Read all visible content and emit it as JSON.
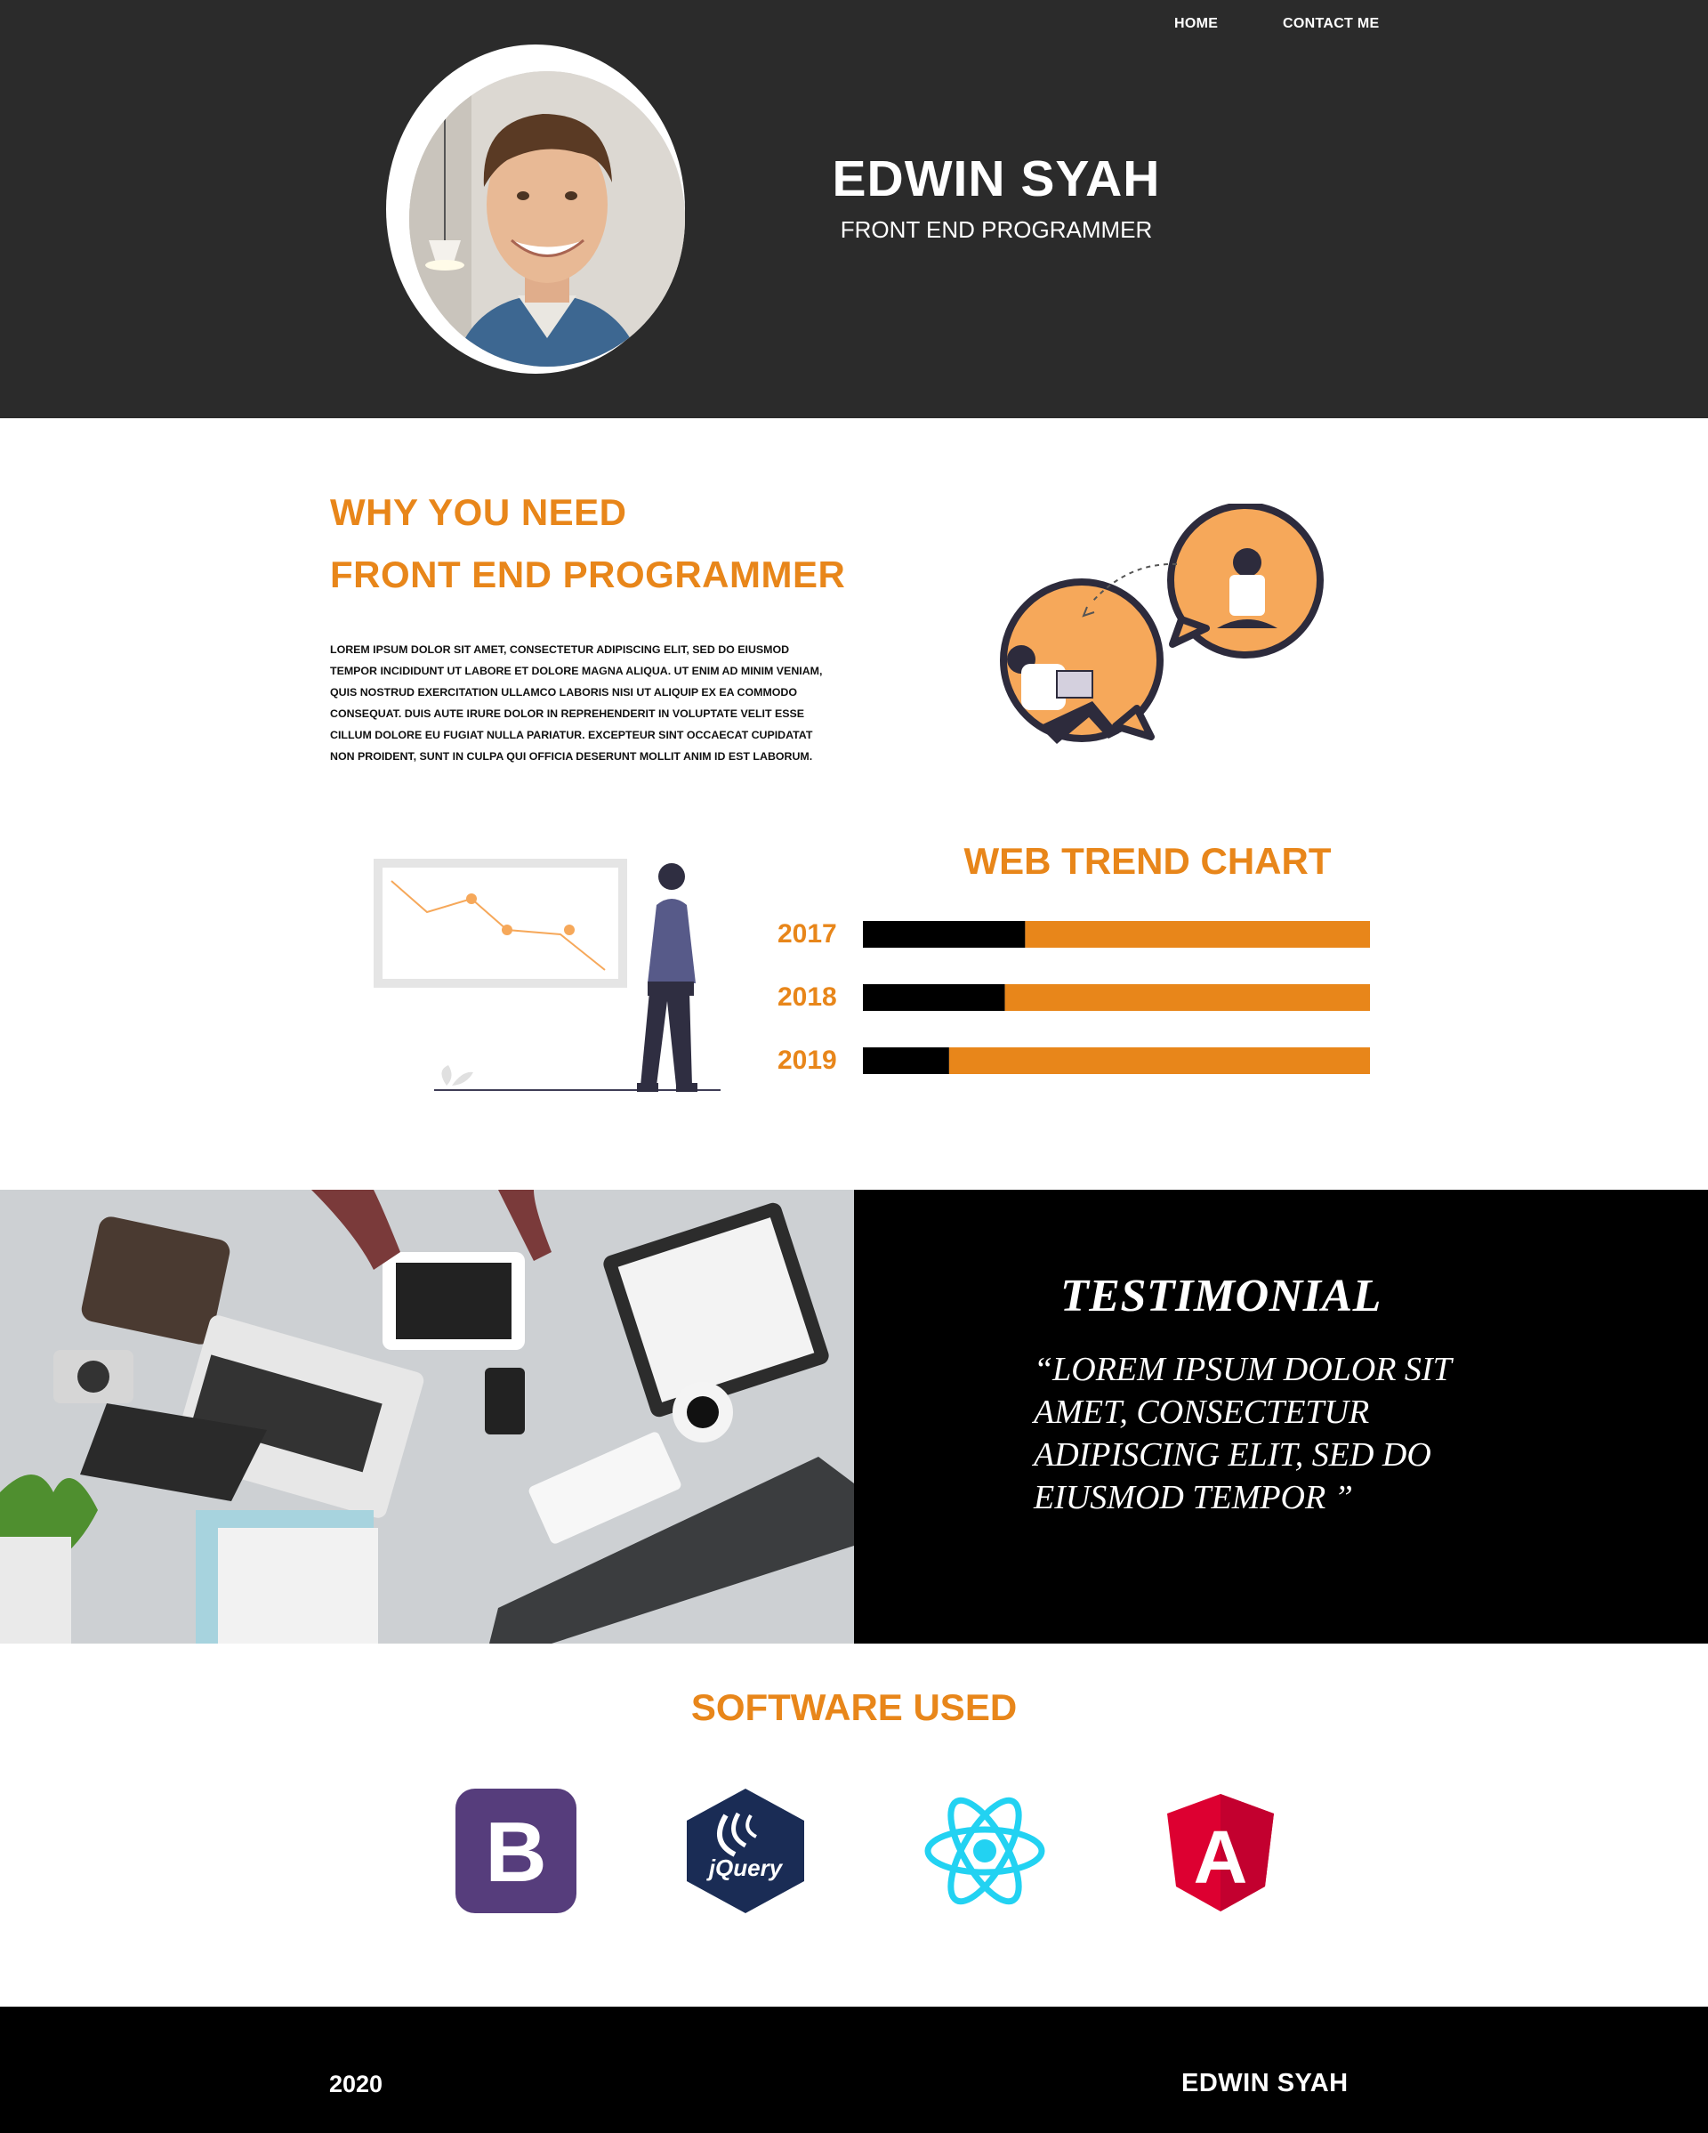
{
  "nav": {
    "home": "HOME",
    "contact": "CONTACT ME"
  },
  "hero": {
    "name": "EDWIN SYAH",
    "role": "FRONT END PROGRAMMER"
  },
  "why": {
    "title_line1": "WHY YOU NEED",
    "title_line2": "FRONT END PROGRAMMER",
    "body": "LOREM IPSUM DOLOR SIT AMET, CONSECTETUR ADIPISCING ELIT, SED DO EIUSMOD TEMPOR INCIDIDUNT UT LABORE ET DOLORE MAGNA ALIQUA. UT ENIM AD MINIM VENIAM, QUIS NOSTRUD EXERCITATION ULLAMCO LABORIS NISI UT ALIQUIP EX EA COMMODO CONSEQUAT. DUIS AUTE IRURE DOLOR IN REPREHENDERIT IN VOLUPTATE VELIT ESSE CILLUM DOLORE EU FUGIAT NULLA PARIATUR. EXCEPTEUR SINT OCCAECAT CUPIDATAT NON PROIDENT, SUNT IN CULPA QUI OFFICIA DESERUNT MOLLIT ANIM ID EST LABORUM."
  },
  "chart_data": {
    "type": "bar",
    "title": "WEB TREND CHART",
    "categories": [
      "2017",
      "2018",
      "2019"
    ],
    "series": [
      {
        "values": [
          32,
          28,
          17
        ],
        "color": "#000000"
      },
      {
        "values": [
          68,
          72,
          83
        ],
        "color": "#e8861a"
      }
    ],
    "xlabel": "",
    "ylabel": "",
    "stacked": true,
    "orientation": "horizontal"
  },
  "testimonial": {
    "title": "TESTIMONIAL",
    "quote": "“LOREM IPSUM DOLOR SIT AMET, CONSECTETUR ADIPISCING ELIT, SED DO EIUSMOD TEMPOR ”"
  },
  "software": {
    "title": "SOFTWARE USED",
    "logos": [
      {
        "icon": "bootstrap-logo",
        "letter": "B",
        "color": "#563d7c"
      },
      {
        "icon": "jquery-logo",
        "text": "jQuery",
        "color": "#1a2c55"
      },
      {
        "icon": "react-logo",
        "color": "#22d2f2"
      },
      {
        "icon": "angular-logo",
        "letter": "A",
        "color": "#dd0031"
      }
    ]
  },
  "footer": {
    "year": "2020",
    "name": "EDWIN SYAH"
  },
  "colors": {
    "accent": "#e8861a",
    "header_bg": "#2b2b2b",
    "dark": "#000000"
  }
}
